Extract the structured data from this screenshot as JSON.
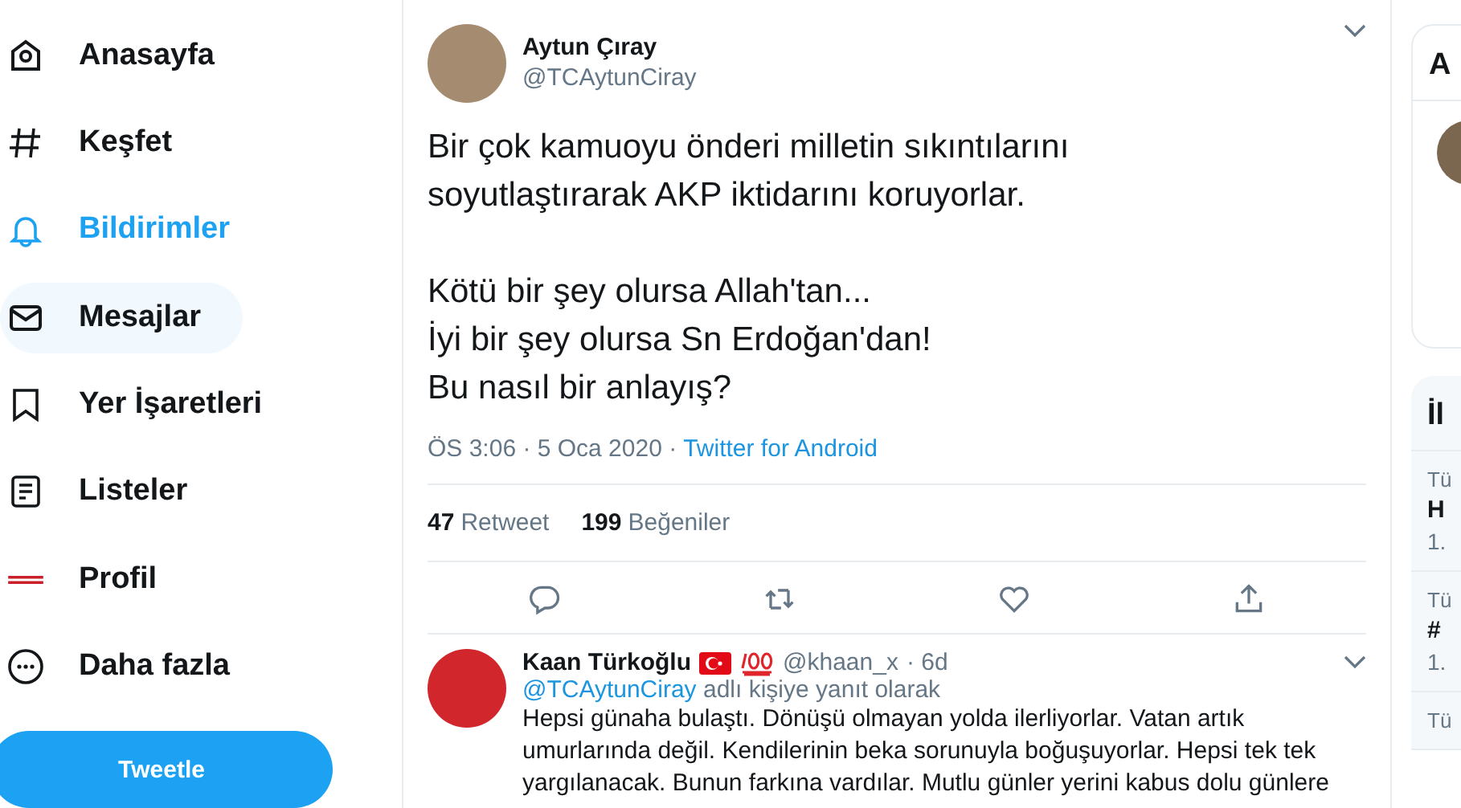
{
  "nav": {
    "items": [
      {
        "kind": "home",
        "label": "Anasayfa",
        "selected": false,
        "hovered": false
      },
      {
        "kind": "explore",
        "label": "Keşfet",
        "selected": false,
        "hovered": false
      },
      {
        "kind": "notifications",
        "label": "Bildirimler",
        "selected": true,
        "hovered": false
      },
      {
        "kind": "messages",
        "label": "Mesajlar",
        "selected": false,
        "hovered": true
      },
      {
        "kind": "bookmarks",
        "label": "Yer İşaretleri",
        "selected": false,
        "hovered": false
      },
      {
        "kind": "lists",
        "label": "Listeler",
        "selected": false,
        "hovered": false
      },
      {
        "kind": "profile",
        "label": "Profil",
        "selected": false,
        "hovered": false
      },
      {
        "kind": "more",
        "label": "Daha fazla",
        "selected": false,
        "hovered": false
      }
    ],
    "tweet_button": "Tweetle"
  },
  "tweet": {
    "author": "Aytun Çıray",
    "handle": "@TCAytunCiray",
    "text": "Bir çok kamuoyu önderi milletin sıkıntılarını\nsoyutlaştırarak AKP iktidarını koruyorlar.\n\nKötü bir şey olursa Allah'tan...\nİyi bir şey olursa Sn Erdoğan'dan!\nBu nasıl bir anlayış?",
    "time": "ÖS 3:06 · 5 Oca 2020 ·",
    "source": "Twitter for Android",
    "stats": [
      {
        "count": "47",
        "label": "Retweet"
      },
      {
        "count": "199",
        "label": "Beğeniler"
      }
    ],
    "actions": [
      {
        "kind": "reply"
      },
      {
        "kind": "retweet"
      },
      {
        "kind": "like"
      },
      {
        "kind": "share"
      }
    ]
  },
  "reply": {
    "author": "Kaan Türkoğlu",
    "handle": "@khaan_x",
    "age": "· 6d",
    "reply_to": "@TCAytunCiray",
    "reply_to_suffix": "adlı kişiye yanıt olarak",
    "text": "Hepsi günaha bulaştı. Dönüşü olmayan yolda ilerliyorlar. Vatan artık umurlarında değil. Kendilerinin beka sorunuyla boğuşuyorlar. Hepsi tek tek yargılanacak. Bunun farkına vardılar. Mutlu günler yerini kabus dolu günlere"
  },
  "sidebar": {
    "card_title": "A",
    "trends_title": "İl",
    "trends": [
      {
        "category": "Tü",
        "name": "H",
        "count": "1."
      },
      {
        "category": "Tü",
        "name": "#",
        "count": "1."
      },
      {
        "category": "Tü"
      }
    ]
  }
}
